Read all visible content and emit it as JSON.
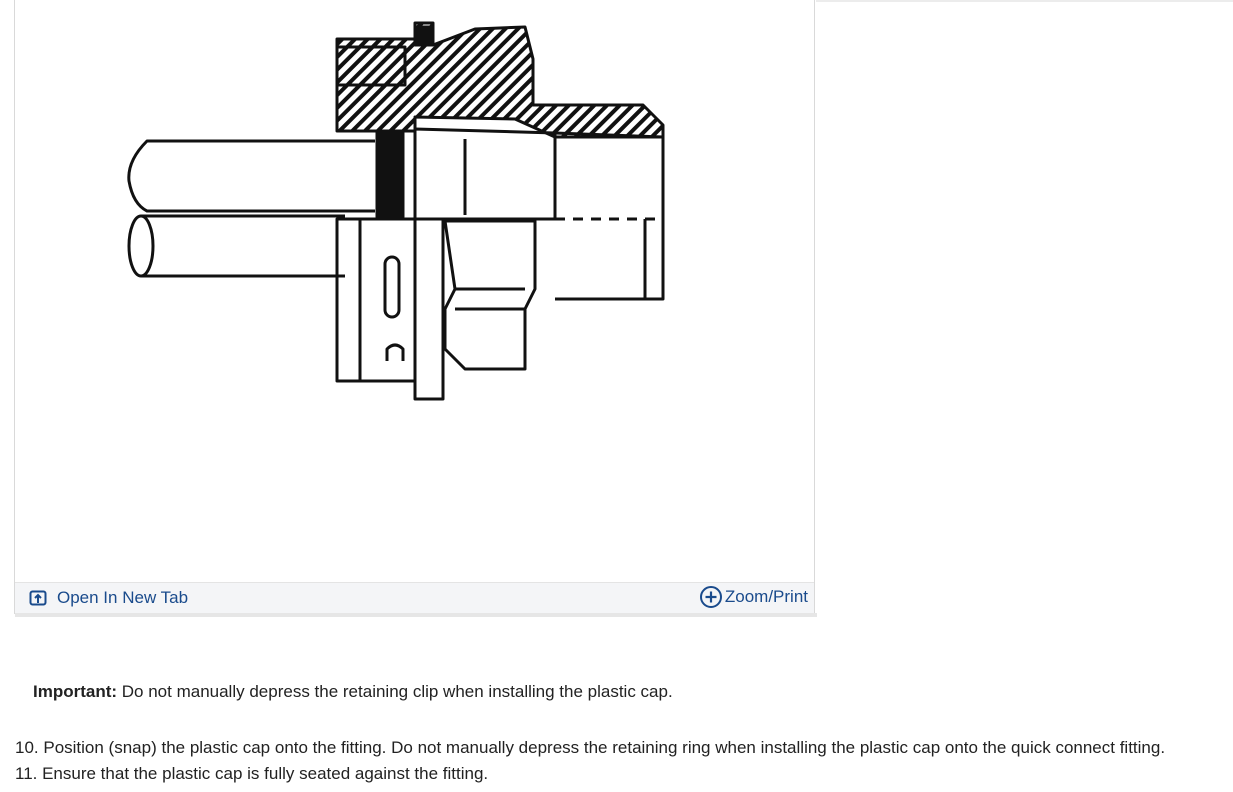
{
  "figure": {
    "open_in_new_tab_label": "Open In New Tab",
    "zoom_print_label": "Zoom/Print",
    "icons": [
      "open-in-new-tab-icon",
      "zoom-plus-icon"
    ],
    "link_color": "#1a4b8c"
  },
  "note": {
    "label": "Important:",
    "text": " Do not manually depress the retaining clip when installing the plastic cap."
  },
  "steps": [
    "10. Position (snap) the plastic cap onto the fitting. Do not manually depress the retaining ring when installing the plastic cap onto the quick connect fitting.",
    "11. Ensure that the plastic cap is fully seated against the fitting."
  ]
}
